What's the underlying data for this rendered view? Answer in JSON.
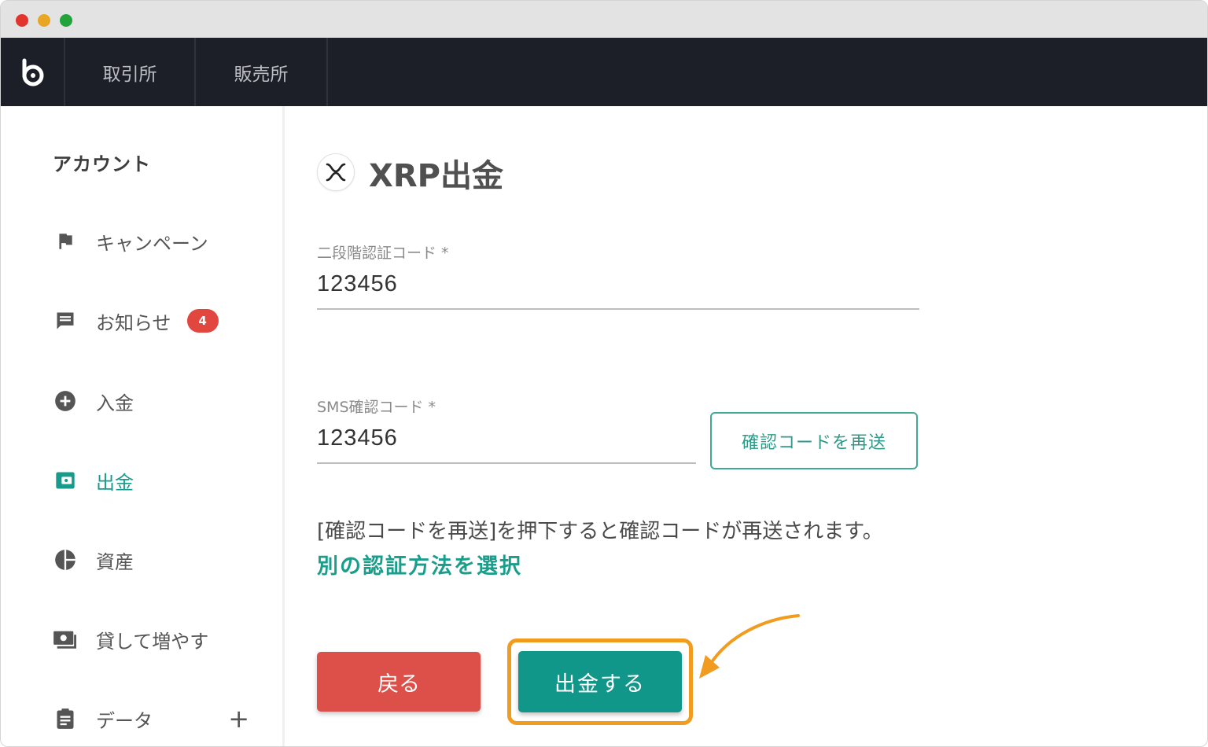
{
  "window": {
    "controls": [
      "close",
      "minimize",
      "maximize"
    ]
  },
  "topnav": {
    "logo_icon": "bitbank-logo-icon",
    "tabs": [
      {
        "label": "取引所"
      },
      {
        "label": "販売所"
      }
    ]
  },
  "sidebar": {
    "title": "アカウント",
    "items": [
      {
        "label": "キャンペーン",
        "icon": "flag-icon"
      },
      {
        "label": "お知らせ",
        "icon": "message-icon",
        "badge": "4"
      },
      {
        "label": "入金",
        "icon": "plus-circle-icon"
      },
      {
        "label": "出金",
        "icon": "wallet-icon",
        "active": true
      },
      {
        "label": "資産",
        "icon": "pie-chart-icon"
      },
      {
        "label": "貸して増やす",
        "icon": "lend-icon"
      },
      {
        "label": "データ",
        "icon": "clipboard-icon",
        "expand": "+"
      }
    ]
  },
  "main": {
    "coin_icon": "xrp-icon",
    "title": "XRP出金",
    "two_factor": {
      "label": "二段階認証コード *",
      "value": "123456"
    },
    "sms": {
      "label": "SMS確認コード *",
      "value": "123456"
    },
    "resend_button": "確認コードを再送",
    "info_text": "[確認コードを再送]を押下すると確認コードが再送されます。",
    "alt_method_link": "別の認証方法を選択",
    "back_button": "戻る",
    "withdraw_button": "出金する"
  },
  "colors": {
    "accent": "#11968a",
    "danger": "#dd504a",
    "highlight": "#f29c1f",
    "nav_bg": "#1c1f28",
    "badge": "#e1463f"
  }
}
